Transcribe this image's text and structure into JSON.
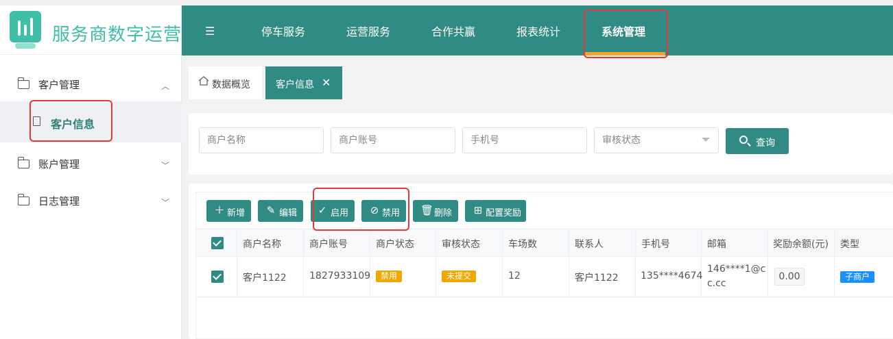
{
  "app": {
    "title": "服务商数字运营"
  },
  "sidebar": {
    "groups": [
      {
        "label": "客户管理",
        "expanded": true,
        "chevron": "︿"
      },
      {
        "label": "账户管理",
        "expanded": false,
        "chevron": "﹀"
      },
      {
        "label": "日志管理",
        "expanded": false,
        "chevron": "﹀"
      }
    ],
    "active_item": {
      "label": "客户信息"
    }
  },
  "topnav": {
    "toggle_icon": "☰",
    "items": [
      {
        "label": "停车服务"
      },
      {
        "label": "运营服务"
      },
      {
        "label": "合作共赢"
      },
      {
        "label": "报表统计"
      },
      {
        "label": "系统管理",
        "active": true
      }
    ]
  },
  "tabs": {
    "home": {
      "label": "数据概览"
    },
    "active": {
      "label": "客户信息",
      "close": "✕"
    }
  },
  "search": {
    "merchant_name_placeholder": "商户名称",
    "merchant_account_placeholder": "商户账号",
    "phone_placeholder": "手机号",
    "audit_status_placeholder": "审核状态",
    "query_label": "查询"
  },
  "toolbar": {
    "add_label": "新增",
    "edit_label": "编辑",
    "enable_label": "启用",
    "disable_label": "禁用",
    "delete_label": "删除",
    "reward_label": "配置奖励"
  },
  "table": {
    "columns": [
      "商户名称",
      "商户账号",
      "商户状态",
      "审核状态",
      "车场数",
      "联系人",
      "手机号",
      "邮箱",
      "奖励余额(元)",
      "类型"
    ],
    "rows": [
      {
        "checked": true,
        "merchant_name": "客户1122",
        "merchant_account": "1827933109",
        "merchant_status": "禁用",
        "audit_status": "未提交",
        "parking_count": "12",
        "contact": "客户1122",
        "phone": "135****4674",
        "email_line1": "146****1@c",
        "email_line2": "c.cc",
        "reward_balance": "0.00",
        "type": "子商户"
      }
    ]
  },
  "colors": {
    "primary": "#2f8b84",
    "accent": "#f5a623",
    "highlight": "#e53935",
    "badge_orange": "#f0a800",
    "badge_blue": "#1890ff"
  }
}
